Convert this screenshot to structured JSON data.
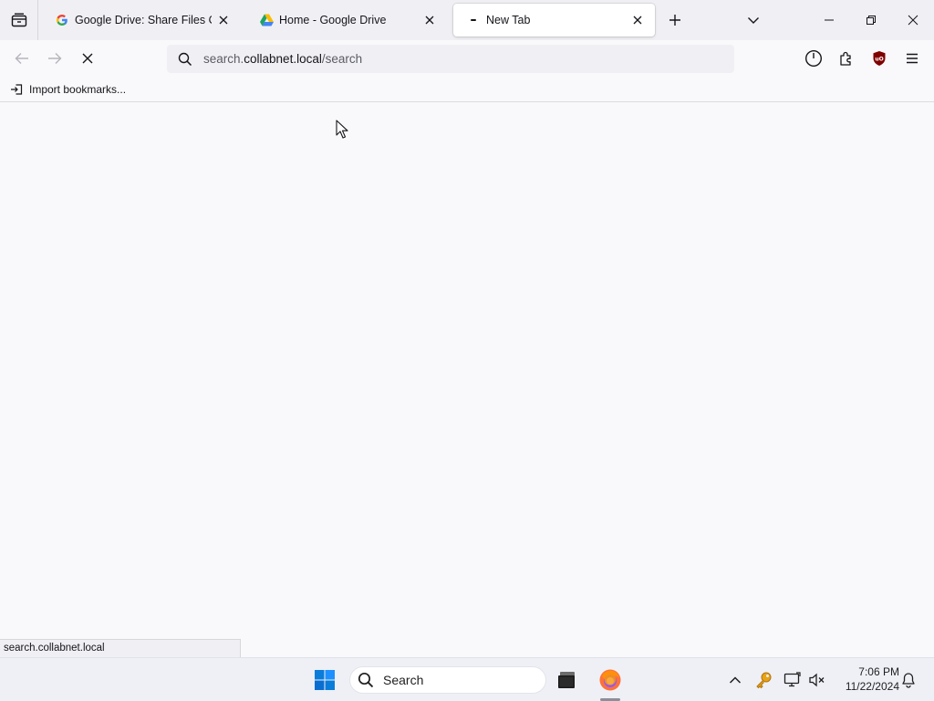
{
  "tabs": [
    {
      "label": "Google Drive: Share Files Online",
      "favicon": "google-g-icon"
    },
    {
      "label": "Home - Google Drive",
      "favicon": "google-drive-icon"
    },
    {
      "label": "New Tab",
      "favicon": "dot-icon",
      "active": true
    }
  ],
  "navbar": {
    "url_prefix": "search.",
    "url_domain": "collabnet.local",
    "url_path": "/search"
  },
  "bookmarks": {
    "import_label": "Import bookmarks..."
  },
  "status": {
    "text": "search.collabnet.local"
  },
  "taskbar": {
    "search_label": "Search",
    "time": "7:06 PM",
    "date": "11/22/2024"
  },
  "colors": {
    "ublock": "#800000",
    "firefox_orange": "#ff7139",
    "windows_blue": "#0a7cd9"
  }
}
